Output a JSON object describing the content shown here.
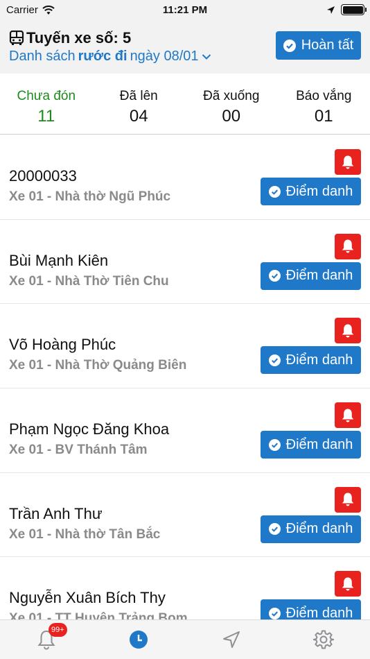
{
  "status_bar": {
    "carrier": "Carrier",
    "time": "11:21 PM"
  },
  "header": {
    "route_title": "Tuyến xe số: 5",
    "subtitle_prefix": "Danh sách",
    "subtitle_mode": "rước đi",
    "subtitle_date": "ngày 08/01",
    "done_label": "Hoàn tất"
  },
  "tabs": [
    {
      "label": "Chưa đón",
      "count": "11"
    },
    {
      "label": "Đã lên",
      "count": "04"
    },
    {
      "label": "Đã xuống",
      "count": "00"
    },
    {
      "label": "Báo vắng",
      "count": "01"
    }
  ],
  "students": [
    {
      "name": "20000033",
      "sub": "Xe 01 - Nhà thờ Ngũ Phúc"
    },
    {
      "name": "Bùi Mạnh Kiên",
      "sub": "Xe 01 - Nhà Thờ Tiên Chu"
    },
    {
      "name": "Võ Hoàng Phúc",
      "sub": "Xe 01 - Nhà Thờ Quảng Biên"
    },
    {
      "name": "Phạm Ngọc Đăng Khoa",
      "sub": "Xe 01 - BV Thánh Tâm"
    },
    {
      "name": "Trần Anh Thư",
      "sub": "Xe 01 - Nhà thờ Tân Bắc"
    },
    {
      "name": "Nguyễn Xuân Bích Thy",
      "sub": "Xe 01 - TT Huyện Trảng Bom"
    }
  ],
  "row_action_label": "Điểm danh",
  "tabbar": {
    "notification_badge": "99+"
  },
  "colors": {
    "primary": "#1f78c8",
    "alert": "#e8231f",
    "active_tab": "#1e8a1e"
  }
}
